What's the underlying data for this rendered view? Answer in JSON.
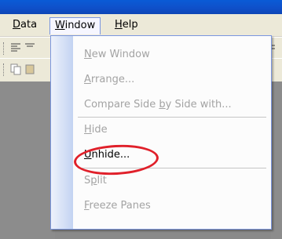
{
  "menubar": {
    "data": {
      "label_pre": "",
      "label_u": "D",
      "label_post": "ata"
    },
    "window": {
      "label_pre": "",
      "label_u": "W",
      "label_post": "indow"
    },
    "help": {
      "label_pre": "",
      "label_u": "H",
      "label_post": "elp"
    }
  },
  "window_menu": {
    "items": [
      {
        "pre": "",
        "u": "N",
        "post": "ew Window",
        "enabled": false
      },
      {
        "pre": "",
        "u": "A",
        "post": "rrange...",
        "enabled": false
      },
      {
        "pre": "Compare Side ",
        "u": "b",
        "post": "y Side with...",
        "enabled": false
      },
      {
        "pre": "",
        "u": "H",
        "post": "ide",
        "enabled": false
      },
      {
        "pre": "",
        "u": "U",
        "post": "nhide...",
        "enabled": true,
        "highlighted": true
      },
      {
        "pre": "S",
        "u": "p",
        "post": "lit",
        "enabled": false
      },
      {
        "pre": "",
        "u": "F",
        "post": "reeze Panes",
        "enabled": false
      }
    ]
  },
  "annotation": {
    "color": "#e0202a",
    "target": "Unhide..."
  }
}
